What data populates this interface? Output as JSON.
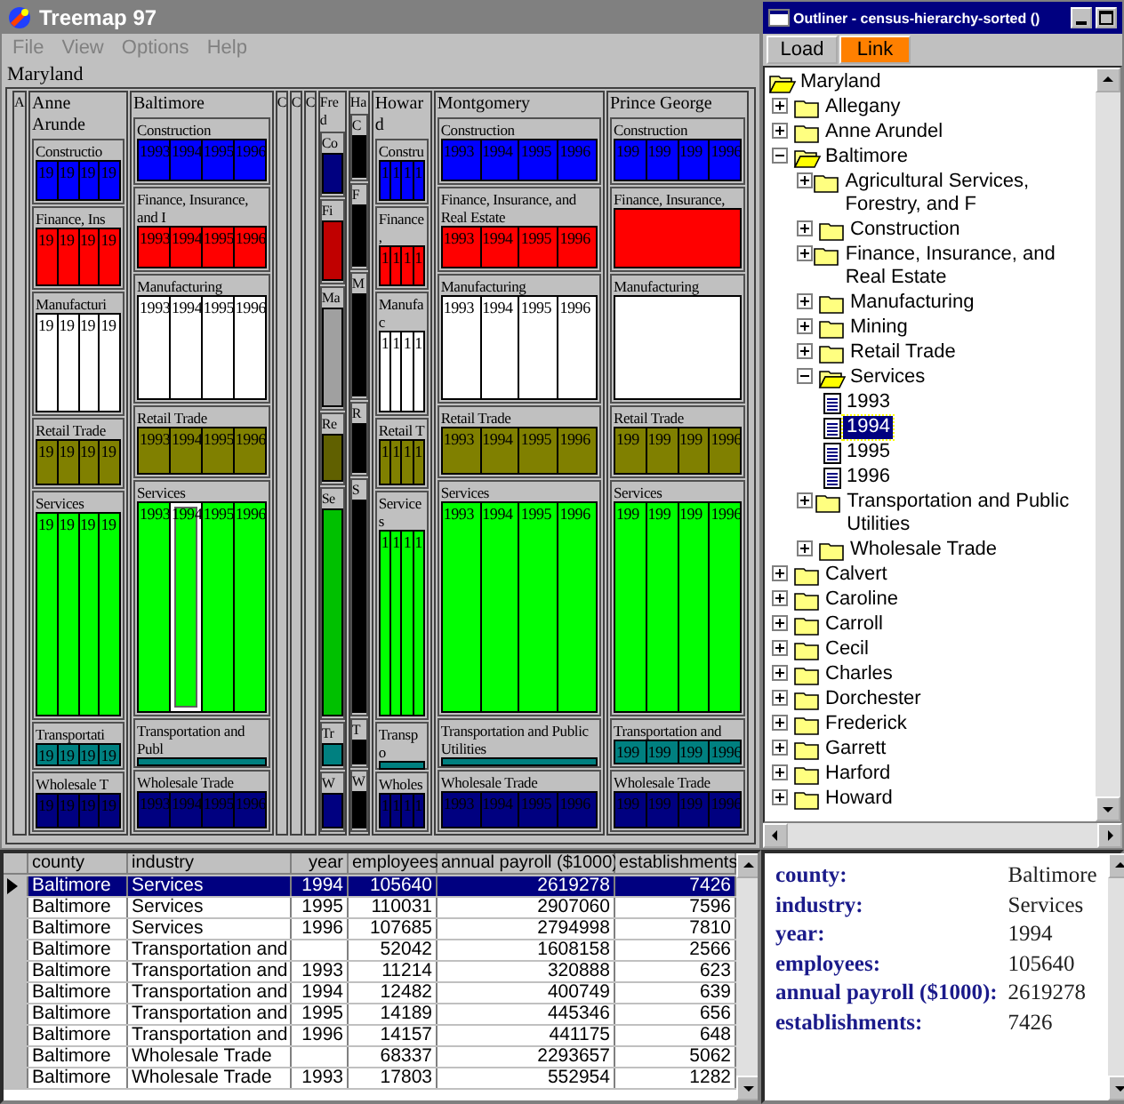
{
  "treemap_window": {
    "title": "Treemap 97",
    "menu": [
      "File",
      "View",
      "Options",
      "Help"
    ],
    "root_label": "Maryland",
    "counties": [
      {
        "label": "A"
      },
      {
        "label": "Anne Arunde",
        "industries": [
          {
            "label": "Constructio",
            "color": "#0000ff",
            "years": [
              {
                "label": "19",
                "selected": false
              },
              {
                "label": "19",
                "selected": false
              },
              {
                "label": "19",
                "selected": false
              },
              {
                "label": "19",
                "selected": false
              }
            ]
          },
          {
            "label": "Finance, Ins",
            "color": "#ff0000",
            "years": [
              {
                "label": "19",
                "selected": false
              },
              {
                "label": "19",
                "selected": false
              },
              {
                "label": "19",
                "selected": false
              },
              {
                "label": "19",
                "selected": false
              }
            ]
          },
          {
            "label": "Manufacturi",
            "color": "#ffffff",
            "years": [
              {
                "label": "19",
                "selected": false
              },
              {
                "label": "19",
                "selected": false
              },
              {
                "label": "19",
                "selected": false
              },
              {
                "label": "19",
                "selected": false
              }
            ]
          },
          {
            "label": "Retail Trade",
            "color": "#808000",
            "years": [
              {
                "label": "19",
                "selected": false
              },
              {
                "label": "19",
                "selected": false
              },
              {
                "label": "19",
                "selected": false
              },
              {
                "label": "19",
                "selected": false
              }
            ]
          },
          {
            "label": "Services",
            "color": "#00ff00",
            "years": [
              {
                "label": "19",
                "selected": false
              },
              {
                "label": "19",
                "selected": false
              },
              {
                "label": "19",
                "selected": false
              },
              {
                "label": "19",
                "selected": false
              }
            ]
          },
          {
            "label": "Transportati",
            "color": "#008080",
            "years": [
              {
                "label": "19",
                "selected": false
              },
              {
                "label": "19",
                "selected": false
              },
              {
                "label": "19",
                "selected": false
              },
              {
                "label": "19",
                "selected": false
              }
            ]
          },
          {
            "label": "Wholesale T",
            "color": "#000080",
            "years": [
              {
                "label": "19",
                "selected": false
              },
              {
                "label": "19",
                "selected": false
              },
              {
                "label": "19",
                "selected": false
              },
              {
                "label": "19",
                "selected": false
              }
            ]
          }
        ]
      },
      {
        "label": "Baltimore",
        "industries": [
          {
            "label": "Construction",
            "color": "#0000ff",
            "years": [
              {
                "label": "1993",
                "selected": false
              },
              {
                "label": "1994",
                "selected": false
              },
              {
                "label": "1995",
                "selected": false
              },
              {
                "label": "1996",
                "selected": false
              }
            ]
          },
          {
            "label": "Finance, Insurance, and I",
            "color": "#ff0000",
            "years": [
              {
                "label": "1993",
                "selected": false
              },
              {
                "label": "1994",
                "selected": false
              },
              {
                "label": "1995",
                "selected": false
              },
              {
                "label": "1996",
                "selected": false
              }
            ]
          },
          {
            "label": "Manufacturing",
            "color": "#ffffff",
            "years": [
              {
                "label": "1993",
                "selected": false
              },
              {
                "label": "1994",
                "selected": false
              },
              {
                "label": "1995",
                "selected": false
              },
              {
                "label": "1996",
                "selected": false
              }
            ]
          },
          {
            "label": "Retail Trade",
            "color": "#808000",
            "years": [
              {
                "label": "1993",
                "selected": false
              },
              {
                "label": "1994",
                "selected": false
              },
              {
                "label": "1995",
                "selected": false
              },
              {
                "label": "1996",
                "selected": false
              }
            ]
          },
          {
            "label": "Services",
            "color": "#00ff00",
            "years": [
              {
                "label": "1993",
                "selected": false
              },
              {
                "label": "1994",
                "selected": true
              },
              {
                "label": "1995",
                "selected": false
              },
              {
                "label": "1996",
                "selected": false
              }
            ]
          },
          {
            "label": "Transportation and Publ",
            "color": "#008080"
          },
          {
            "label": "Wholesale Trade",
            "color": "#000080",
            "years": [
              {
                "label": "1993",
                "selected": false
              },
              {
                "label": "1994",
                "selected": false
              },
              {
                "label": "1995",
                "selected": false
              },
              {
                "label": "1996",
                "selected": false
              }
            ]
          }
        ]
      },
      {
        "label": "C"
      },
      {
        "label": "C"
      },
      {
        "label": "C"
      },
      {
        "label": "Fred",
        "industries": [
          {
            "label": "Co",
            "color": "#000080"
          },
          {
            "label": "Fi",
            "color": "#c00000"
          },
          {
            "label": "Ma",
            "color": "#a0a0a0"
          },
          {
            "label": "Re",
            "color": "#606000"
          },
          {
            "label": "Se",
            "color": "#00c000"
          },
          {
            "label": "Tr",
            "color": "#008080"
          },
          {
            "label": "W",
            "color": "#000080"
          }
        ]
      },
      {
        "label": "Ha",
        "industries": [
          {
            "label": "C",
            "color": "#000000"
          },
          {
            "label": "F",
            "color": "#000000"
          },
          {
            "label": "M",
            "color": "#000000"
          },
          {
            "label": "R",
            "color": "#000000"
          },
          {
            "label": "S",
            "color": "#000000"
          },
          {
            "label": "T",
            "color": "#000000"
          },
          {
            "label": "W",
            "color": "#000000"
          }
        ]
      },
      {
        "label": "Howard",
        "industries": [
          {
            "label": "Constru",
            "color": "#0000ff",
            "years": [
              {
                "label": "1",
                "selected": false
              },
              {
                "label": "1",
                "selected": false
              },
              {
                "label": "1",
                "selected": false
              },
              {
                "label": "1",
                "selected": false
              }
            ]
          },
          {
            "label": "Finance,",
            "color": "#ff0000",
            "years": [
              {
                "label": "1",
                "selected": false
              },
              {
                "label": "1",
                "selected": false
              },
              {
                "label": "1",
                "selected": false
              },
              {
                "label": "1",
                "selected": false
              }
            ]
          },
          {
            "label": "Manufac",
            "color": "#ffffff",
            "years": [
              {
                "label": "1",
                "selected": false
              },
              {
                "label": "1",
                "selected": false
              },
              {
                "label": "1",
                "selected": false
              },
              {
                "label": "1",
                "selected": false
              }
            ]
          },
          {
            "label": "Retail T",
            "color": "#808000",
            "years": [
              {
                "label": "1",
                "selected": false
              },
              {
                "label": "1",
                "selected": false
              },
              {
                "label": "1",
                "selected": false
              },
              {
                "label": "1",
                "selected": false
              }
            ]
          },
          {
            "label": "Services",
            "color": "#00ff00",
            "years": [
              {
                "label": "1",
                "selected": false
              },
              {
                "label": "1",
                "selected": false
              },
              {
                "label": "1",
                "selected": false
              },
              {
                "label": "1",
                "selected": false
              }
            ]
          },
          {
            "label": "Transpo",
            "color": "#008080"
          },
          {
            "label": "Wholes",
            "color": "#000080",
            "years": [
              {
                "label": "1",
                "selected": false
              },
              {
                "label": "1",
                "selected": false
              },
              {
                "label": "1",
                "selected": false
              },
              {
                "label": "1",
                "selected": false
              }
            ]
          }
        ]
      },
      {
        "label": "Montgomery",
        "industries": [
          {
            "label": "Construction",
            "color": "#0000ff",
            "years": [
              {
                "label": "1993",
                "selected": false
              },
              {
                "label": "1994",
                "selected": false
              },
              {
                "label": "1995",
                "selected": false
              },
              {
                "label": "1996",
                "selected": false
              }
            ]
          },
          {
            "label": "Finance, Insurance, and Real Estate",
            "color": "#ff0000",
            "years": [
              {
                "label": "1993",
                "selected": false
              },
              {
                "label": "1994",
                "selected": false
              },
              {
                "label": "1995",
                "selected": false
              },
              {
                "label": "1996",
                "selected": false
              }
            ]
          },
          {
            "label": "Manufacturing",
            "color": "#ffffff",
            "years": [
              {
                "label": "1993",
                "selected": false
              },
              {
                "label": "1994",
                "selected": false
              },
              {
                "label": "1995",
                "selected": false
              },
              {
                "label": "1996",
                "selected": false
              }
            ]
          },
          {
            "label": "Retail Trade",
            "color": "#808000",
            "years": [
              {
                "label": "1993",
                "selected": false
              },
              {
                "label": "1994",
                "selected": false
              },
              {
                "label": "1995",
                "selected": false
              },
              {
                "label": "1996",
                "selected": false
              }
            ]
          },
          {
            "label": "Services",
            "color": "#00ff00",
            "years": [
              {
                "label": "1993",
                "selected": false
              },
              {
                "label": "1994",
                "selected": false
              },
              {
                "label": "1995",
                "selected": false
              },
              {
                "label": "1996",
                "selected": false
              }
            ]
          },
          {
            "label": "Transportation and Public Utilities",
            "color": "#008080"
          },
          {
            "label": "Wholesale Trade",
            "color": "#000080",
            "years": [
              {
                "label": "1993",
                "selected": false
              },
              {
                "label": "1994",
                "selected": false
              },
              {
                "label": "1995",
                "selected": false
              },
              {
                "label": "1996",
                "selected": false
              }
            ]
          }
        ]
      },
      {
        "label": "Prince George",
        "industries": [
          {
            "label": "Construction",
            "color": "#0000ff",
            "years": [
              {
                "label": "199",
                "selected": false
              },
              {
                "label": "199",
                "selected": false
              },
              {
                "label": "199",
                "selected": false
              },
              {
                "label": "1996",
                "selected": false
              }
            ]
          },
          {
            "label": "Finance, Insurance,",
            "color": "#ff0000"
          },
          {
            "label": "Manufacturing",
            "color": "#ffffff"
          },
          {
            "label": "Retail Trade",
            "color": "#808000",
            "years": [
              {
                "label": "199",
                "selected": false
              },
              {
                "label": "199",
                "selected": false
              },
              {
                "label": "199",
                "selected": false
              },
              {
                "label": "1996",
                "selected": false
              }
            ]
          },
          {
            "label": "Services",
            "color": "#00ff00",
            "years": [
              {
                "label": "199",
                "selected": false
              },
              {
                "label": "199",
                "selected": false
              },
              {
                "label": "199",
                "selected": false
              },
              {
                "label": "1996",
                "selected": false
              }
            ]
          },
          {
            "label": "Transportation and",
            "color": "#008080",
            "years": [
              {
                "label": "199",
                "selected": false
              },
              {
                "label": "199",
                "selected": false
              },
              {
                "label": "199",
                "selected": false
              },
              {
                "label": "1996",
                "selected": false
              }
            ]
          },
          {
            "label": "Wholesale Trade",
            "color": "#000080",
            "years": [
              {
                "label": "199",
                "selected": false
              },
              {
                "label": "199",
                "selected": false
              },
              {
                "label": "199",
                "selected": false
              },
              {
                "label": "1996",
                "selected": false
              }
            ]
          }
        ]
      }
    ]
  },
  "table": {
    "columns": [
      "county",
      "industry",
      "year",
      "employees",
      "annual payroll ($1000)",
      "establishments"
    ],
    "rows": [
      {
        "selected": true,
        "cells": [
          "Baltimore",
          "Services",
          "1994",
          "105640",
          "2619278",
          "7426"
        ]
      },
      {
        "selected": false,
        "cells": [
          "Baltimore",
          "Services",
          "1995",
          "110031",
          "2907060",
          "7596"
        ]
      },
      {
        "selected": false,
        "cells": [
          "Baltimore",
          "Services",
          "1996",
          "107685",
          "2794998",
          "7810"
        ]
      },
      {
        "selected": false,
        "cells": [
          "Baltimore",
          "Transportation and",
          null,
          "52042",
          "1608158",
          "2566"
        ]
      },
      {
        "selected": false,
        "cells": [
          "Baltimore",
          "Transportation and",
          "1993",
          "11214",
          "320888",
          "623"
        ]
      },
      {
        "selected": false,
        "cells": [
          "Baltimore",
          "Transportation and",
          "1994",
          "12482",
          "400749",
          "639"
        ]
      },
      {
        "selected": false,
        "cells": [
          "Baltimore",
          "Transportation and",
          "1995",
          "14189",
          "445346",
          "656"
        ]
      },
      {
        "selected": false,
        "cells": [
          "Baltimore",
          "Transportation and",
          "1996",
          "14157",
          "441175",
          "648"
        ]
      },
      {
        "selected": false,
        "cells": [
          "Baltimore",
          "Wholesale Trade",
          null,
          "68337",
          "2293657",
          "5062"
        ]
      },
      {
        "selected": false,
        "cells": [
          "Baltimore",
          "Wholesale Trade",
          "1993",
          "17803",
          "552954",
          "1282"
        ]
      }
    ]
  },
  "outliner_window": {
    "title": "Outliner - census-hierarchy-sorted ()",
    "buttons": [
      {
        "label": "Load",
        "on": false
      },
      {
        "label": "Link",
        "on": true
      }
    ],
    "tree": {
      "label": "Maryland",
      "kind": "folder",
      "expanded": true,
      "selected": false,
      "children": [
        {
          "label": "Allegany",
          "kind": "folder",
          "expanded": false,
          "selected": false
        },
        {
          "label": "Anne Arundel",
          "kind": "folder",
          "expanded": false,
          "selected": false
        },
        {
          "label": "Baltimore",
          "kind": "folder",
          "expanded": true,
          "selected": false,
          "children": [
            {
              "label": "Agricultural Services, Forestry, and F",
              "kind": "folder",
              "expanded": false,
              "selected": false
            },
            {
              "label": "Construction",
              "kind": "folder",
              "expanded": false,
              "selected": false
            },
            {
              "label": "Finance, Insurance, and Real Estate",
              "kind": "folder",
              "expanded": false,
              "selected": false
            },
            {
              "label": "Manufacturing",
              "kind": "folder",
              "expanded": false,
              "selected": false
            },
            {
              "label": "Mining",
              "kind": "folder",
              "expanded": false,
              "selected": false
            },
            {
              "label": "Retail Trade",
              "kind": "folder",
              "expanded": false,
              "selected": false
            },
            {
              "label": "Services",
              "kind": "folder",
              "expanded": true,
              "selected": false,
              "children": [
                {
                  "label": "1993",
                  "kind": "file",
                  "selected": false
                },
                {
                  "label": "1994",
                  "kind": "file",
                  "selected": true
                },
                {
                  "label": "1995",
                  "kind": "file",
                  "selected": false
                },
                {
                  "label": "1996",
                  "kind": "file",
                  "selected": false
                }
              ]
            },
            {
              "label": "Transportation and Public Utilities",
              "kind": "folder",
              "expanded": false,
              "selected": false
            },
            {
              "label": "Wholesale Trade",
              "kind": "folder",
              "expanded": false,
              "selected": false
            }
          ]
        },
        {
          "label": "Calvert",
          "kind": "folder",
          "expanded": false,
          "selected": false
        },
        {
          "label": "Caroline",
          "kind": "folder",
          "expanded": false,
          "selected": false
        },
        {
          "label": "Carroll",
          "kind": "folder",
          "expanded": false,
          "selected": false
        },
        {
          "label": "Cecil",
          "kind": "folder",
          "expanded": false,
          "selected": false
        },
        {
          "label": "Charles",
          "kind": "folder",
          "expanded": false,
          "selected": false
        },
        {
          "label": "Dorchester",
          "kind": "folder",
          "expanded": false,
          "selected": false
        },
        {
          "label": "Frederick",
          "kind": "folder",
          "expanded": false,
          "selected": false
        },
        {
          "label": "Garrett",
          "kind": "folder",
          "expanded": false,
          "selected": false
        },
        {
          "label": "Harford",
          "kind": "folder",
          "expanded": false,
          "selected": false
        },
        {
          "label": "Howard",
          "kind": "folder",
          "expanded": false,
          "selected": false
        }
      ]
    }
  },
  "details": [
    {
      "label": "county:",
      "value": "Baltimore"
    },
    {
      "label": "industry:",
      "value": "Services"
    },
    {
      "label": "year:",
      "value": "1994"
    },
    {
      "label": "employees:",
      "value": "105640"
    },
    {
      "label": "annual payroll ($1000):",
      "value": "2619278"
    },
    {
      "label": "establishments:",
      "value": "7426"
    }
  ]
}
